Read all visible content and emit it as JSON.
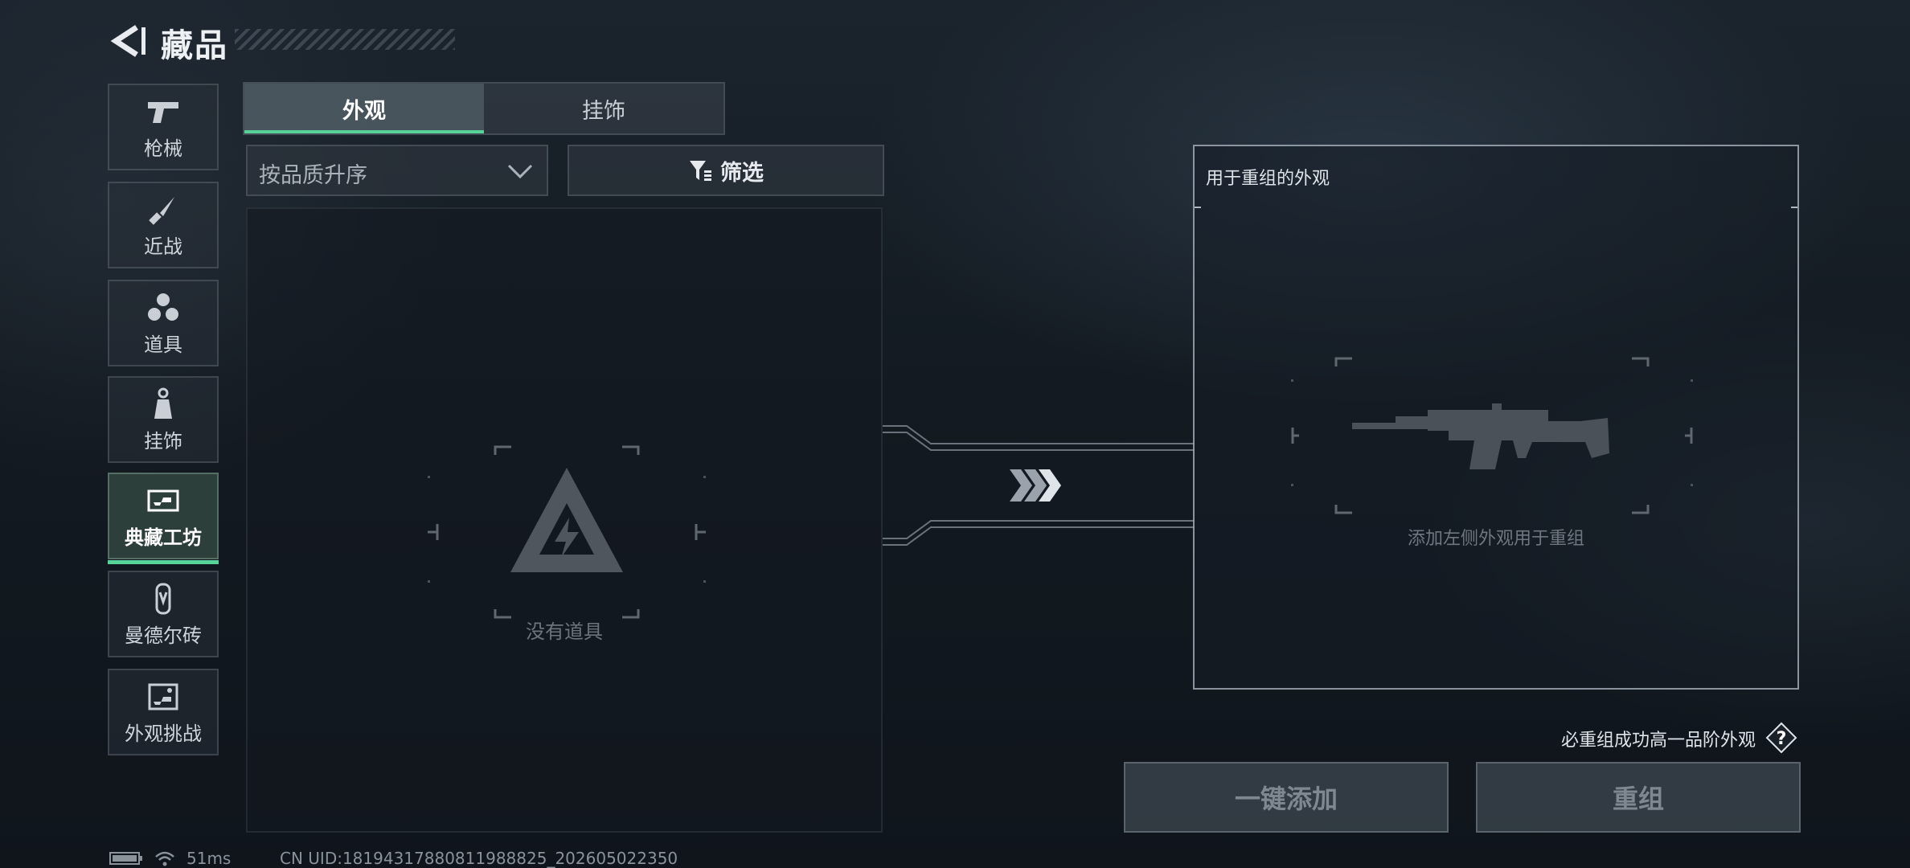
{
  "header": {
    "title": "藏品"
  },
  "sidebar": {
    "items": [
      {
        "label": "枪械",
        "icon": "pistol-icon",
        "active": false
      },
      {
        "label": "近战",
        "icon": "knife-icon",
        "active": false
      },
      {
        "label": "道具",
        "icon": "grenades-icon",
        "active": false
      },
      {
        "label": "挂饰",
        "icon": "charm-icon",
        "active": false
      },
      {
        "label": "典藏工坊",
        "icon": "workshop-icon",
        "active": true
      },
      {
        "label": "曼德尔砖",
        "icon": "brick-icon",
        "active": false
      },
      {
        "label": "外观挑战",
        "icon": "challenge-icon",
        "active": false
      }
    ]
  },
  "tabs": [
    {
      "label": "外观",
      "active": true
    },
    {
      "label": "挂饰",
      "active": false
    }
  ],
  "sort": {
    "label": "按品质升序"
  },
  "filter": {
    "label": "筛选"
  },
  "inventory": {
    "empty_text": "没有道具"
  },
  "recombine": {
    "title": "用于重组的外观",
    "hint": "添加左侧外观用于重组",
    "guarantee": "必重组成功高一品阶外观",
    "help_label": "?"
  },
  "buttons": {
    "add_all": "一键添加",
    "recombine": "重组"
  },
  "status": {
    "ping": "51ms",
    "uid": "CN UID:18194317880811988825_202605022350"
  },
  "colors": {
    "accent": "#57d39a",
    "panel_border": "#c0c8d0"
  }
}
